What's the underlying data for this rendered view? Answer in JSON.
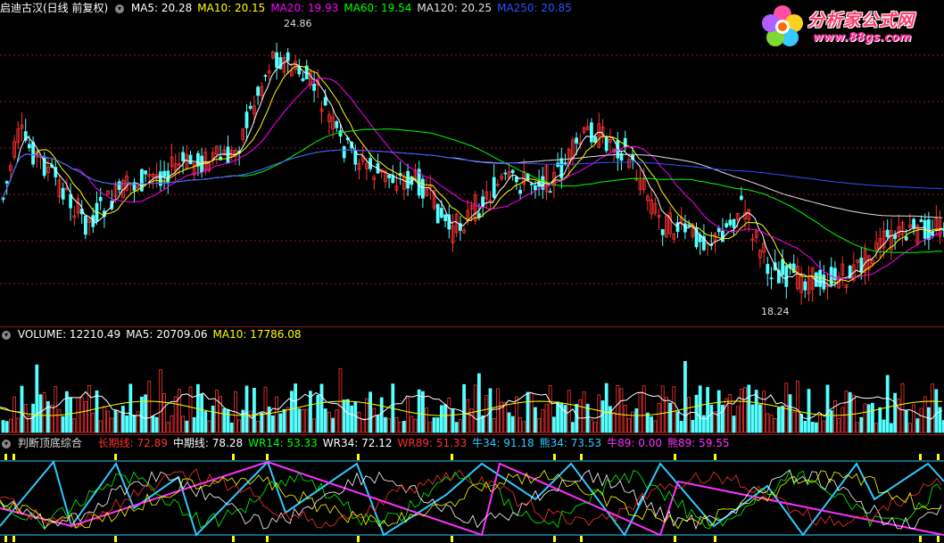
{
  "main_legend": {
    "title": "启迪古汉(日线 前复权)",
    "items": [
      {
        "label": "MA5: 20.28",
        "color": "#ffffff"
      },
      {
        "label": "MA10: 20.15",
        "color": "#ffff00"
      },
      {
        "label": "MA20: 19.93",
        "color": "#ff00ff"
      },
      {
        "label": "MA60: 19.54",
        "color": "#00ff00"
      },
      {
        "label": "MA120: 20.25",
        "color": "#e0e0e0"
      },
      {
        "label": "MA250: 20.85",
        "color": "#3050ff"
      }
    ]
  },
  "price_marks": {
    "high": "24.86",
    "low": "18.24"
  },
  "volume_legend": {
    "items": [
      {
        "label": "VOLUME: 12210.49",
        "color": "#ffffff"
      },
      {
        "label": "MA5: 20709.06",
        "color": "#ffffff"
      },
      {
        "label": "MA10: 17786.08",
        "color": "#ffff00"
      }
    ]
  },
  "indicator_legend": {
    "title": "判断顶底综合",
    "items": [
      {
        "label": "长期线: 72.89",
        "color": "#ff3030"
      },
      {
        "label": "中期线: 78.28",
        "color": "#ffffff"
      },
      {
        "label": "WR14: 53.33",
        "color": "#00ff00"
      },
      {
        "label": "WR34: 72.12",
        "color": "#ffffff"
      },
      {
        "label": "WR89: 51.33",
        "color": "#ff3030"
      },
      {
        "label": "牛34: 91.18",
        "color": "#30c8ff"
      },
      {
        "label": "熊34: 73.53",
        "color": "#30c8ff"
      },
      {
        "label": "牛89: 0.00",
        "color": "#ff30ff"
      },
      {
        "label": "熊89: 59.55",
        "color": "#ff30ff"
      }
    ]
  },
  "watermark": {
    "title": "分析家公式网",
    "url": "www.88gs.com"
  },
  "colors": {
    "up": "#ff3232",
    "down": "#54ffff",
    "grid": "#8b1a1a"
  }
}
